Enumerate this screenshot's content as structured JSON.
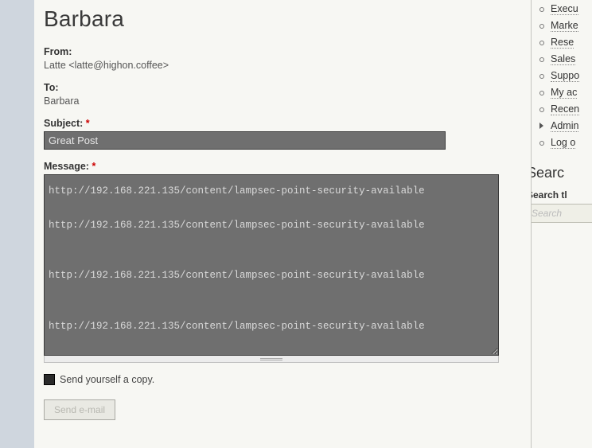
{
  "page": {
    "title": "Barbara"
  },
  "form": {
    "from_label": "From:",
    "from_value": "Latte <latte@highon.coffee>",
    "to_label": "To:",
    "to_value": "Barbara",
    "subject_label": "Subject:",
    "subject_value": "Great Post",
    "message_label": "Message:",
    "message_value": "http://192.168.221.135/content/lampsec-point-security-available\n\nhttp://192.168.221.135/content/lampsec-point-security-available\n\n\nhttp://192.168.221.135/content/lampsec-point-security-available\n\n\nhttp://192.168.221.135/content/lampsec-point-security-available",
    "copy_label": "Send yourself a copy.",
    "submit_label": "Send e-mail",
    "required_marker": "*"
  },
  "sidebar": {
    "nav": [
      {
        "label": "Execu",
        "caret": false
      },
      {
        "label": "Marke",
        "caret": false
      },
      {
        "label": "Rese",
        "caret": false
      },
      {
        "label": "Sales",
        "caret": false
      },
      {
        "label": "Suppo",
        "caret": false
      },
      {
        "label": "My ac",
        "caret": false
      },
      {
        "label": "Recen",
        "caret": false
      },
      {
        "label": "Admin",
        "caret": true
      },
      {
        "label": "Log o",
        "caret": false
      }
    ],
    "search_heading": "Searc",
    "search_label": "Search tl",
    "search_placeholder": "Search"
  }
}
